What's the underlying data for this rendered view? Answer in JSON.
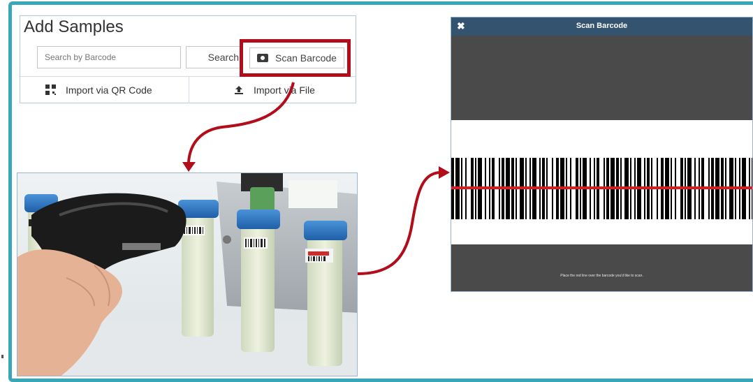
{
  "add_samples": {
    "title": "Add Samples",
    "search_placeholder": "Search by Barcode",
    "search_button": "Search",
    "scan_button": "Scan Barcode",
    "import_qr": "Import via QR Code",
    "import_file": "Import via File"
  },
  "scan_modal": {
    "close_glyph": "✖",
    "title": "Scan Barcode",
    "hint": "Place the red line over the barcode you'd like to scan."
  },
  "colors": {
    "frame": "#3aa7b9",
    "highlight": "#b10d1b",
    "arrow": "#b10d1b",
    "modal_header": "#34536f",
    "scan_line": "#e3181f",
    "tube_cap": "#2f78c4"
  },
  "icons": [
    "camera-icon",
    "qr-code-icon",
    "upload-icon",
    "close-icon"
  ]
}
